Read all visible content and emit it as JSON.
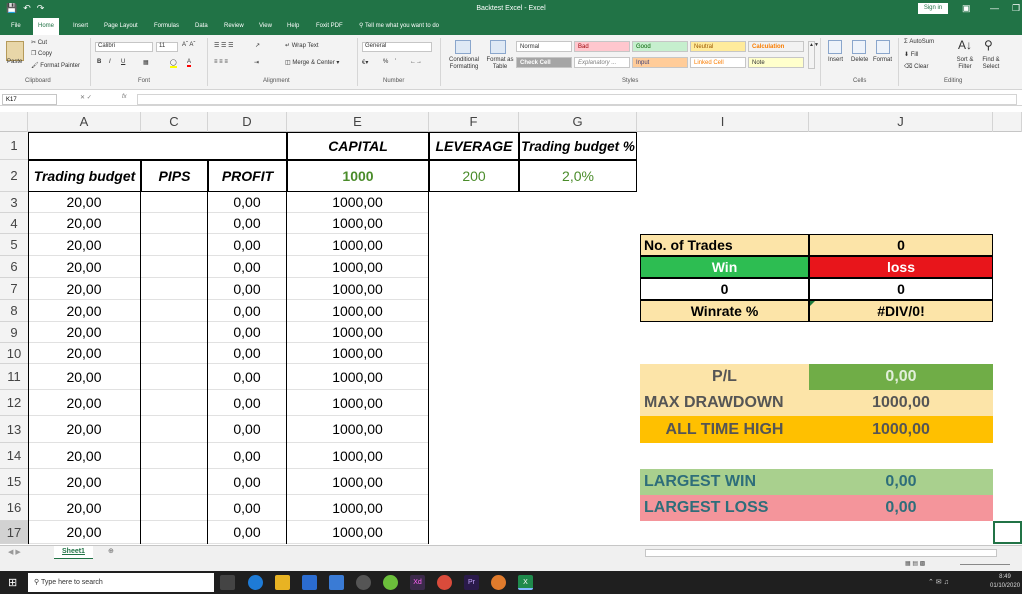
{
  "app": {
    "doc_title": "Backtest Excel  -  Excel",
    "sign_in": "Sign in"
  },
  "menu": {
    "tabs": [
      "File",
      "Home",
      "Insert",
      "Page Layout",
      "Formulas",
      "Data",
      "Review",
      "View",
      "Help",
      "Foxit PDF"
    ],
    "active": "Home",
    "tell_me": "Tell me what you want to do"
  },
  "ribbon": {
    "clipboard": {
      "paste": "Paste",
      "cut": "Cut",
      "copy": "Copy",
      "format_painter": "Format Painter",
      "label": "Clipboard"
    },
    "font": {
      "name": "Calibri",
      "size": "11",
      "label": "Font",
      "bold": "B",
      "italic": "I",
      "underline": "U"
    },
    "alignment": {
      "wrap_text": "Wrap Text",
      "merge_center": "Merge & Center",
      "label": "Alignment"
    },
    "number": {
      "format": "General",
      "percent": "%",
      "label": "Number"
    },
    "styles": {
      "conditional": "Conditional Formatting",
      "format_as_table": "Format as Table",
      "normal": "Normal",
      "bad": "Bad",
      "good": "Good",
      "neutral": "Neutral",
      "calculation": "Calculation",
      "check_cell": "Check Cell",
      "explanatory": "Explanatory ...",
      "input": "Input",
      "linked_cell": "Linked Cell",
      "note": "Note",
      "label": "Styles"
    },
    "cells": {
      "insert": "Insert",
      "delete": "Delete",
      "format": "Format",
      "label": "Cells"
    },
    "editing": {
      "autosum": "AutoSum",
      "fill": "Fill",
      "clear": "Clear",
      "sort_filter": "Sort & Filter",
      "find_select": "Find & Select",
      "label": "Editing"
    }
  },
  "formula_bar": {
    "name_box": "K17",
    "fx": "fx",
    "value": ""
  },
  "columns": [
    "A",
    "C",
    "D",
    "E",
    "F",
    "G",
    "I",
    "J"
  ],
  "rows": [
    "1",
    "2",
    "3",
    "4",
    "5",
    "6",
    "7",
    "8",
    "9",
    "10",
    "11",
    "12",
    "13",
    "14",
    "15",
    "16",
    "17"
  ],
  "headers": {
    "capital": "CAPITAL",
    "leverage": "LEVERAGE",
    "budget_pct_label": "Trading budget %",
    "trading_budget": "Trading budget",
    "pips": "PIPS",
    "profit": "PROFIT",
    "capital_value": "1000",
    "leverage_value": "200",
    "budget_pct_value": "2,0%"
  },
  "data_rows": [
    {
      "budget": "20,00",
      "pips": "",
      "profit": "0,00",
      "capital": "1000,00"
    },
    {
      "budget": "20,00",
      "pips": "",
      "profit": "0,00",
      "capital": "1000,00"
    },
    {
      "budget": "20,00",
      "pips": "",
      "profit": "0,00",
      "capital": "1000,00"
    },
    {
      "budget": "20,00",
      "pips": "",
      "profit": "0,00",
      "capital": "1000,00"
    },
    {
      "budget": "20,00",
      "pips": "",
      "profit": "0,00",
      "capital": "1000,00"
    },
    {
      "budget": "20,00",
      "pips": "",
      "profit": "0,00",
      "capital": "1000,00"
    },
    {
      "budget": "20,00",
      "pips": "",
      "profit": "0,00",
      "capital": "1000,00"
    },
    {
      "budget": "20,00",
      "pips": "",
      "profit": "0,00",
      "capital": "1000,00"
    },
    {
      "budget": "20,00",
      "pips": "",
      "profit": "0,00",
      "capital": "1000,00"
    },
    {
      "budget": "20,00",
      "pips": "",
      "profit": "0,00",
      "capital": "1000,00"
    },
    {
      "budget": "20,00",
      "pips": "",
      "profit": "0,00",
      "capital": "1000,00"
    },
    {
      "budget": "20,00",
      "pips": "",
      "profit": "0,00",
      "capital": "1000,00"
    },
    {
      "budget": "20,00",
      "pips": "",
      "profit": "0,00",
      "capital": "1000,00"
    },
    {
      "budget": "20,00",
      "pips": "",
      "profit": "0,00",
      "capital": "1000,00"
    },
    {
      "budget": "20,00",
      "pips": "",
      "profit": "0,00",
      "capital": "1000,00"
    }
  ],
  "stats": {
    "no_trades_label": "No. of Trades",
    "no_trades_value": "0",
    "win_label": "Win",
    "loss_label": "loss",
    "win_value": "0",
    "loss_value": "0",
    "winrate_label": "Winrate %",
    "winrate_value": "#DIV/0!",
    "pl_label": "P/L",
    "pl_value": "0,00",
    "max_dd_label": "MAX DRAWDOWN",
    "max_dd_value": "1000,00",
    "ath_label": "ALL TIME HIGH",
    "ath_value": "1000,00",
    "largest_win_label": "LARGEST WIN",
    "largest_win_value": "0,00",
    "largest_loss_label": "LARGEST LOSS",
    "largest_loss_value": "0,00"
  },
  "colors": {
    "excel_green": "#217346",
    "peach": "#fce4a8",
    "win_green": "#2dbd52",
    "loss_red": "#e8151b",
    "pl_green": "#70ad47",
    "orange": "#ffc000",
    "light_green": "#a9d08e",
    "pink": "#f4959b"
  },
  "sheet": {
    "tab": "Sheet1"
  },
  "taskbar": {
    "search": "Type here to search",
    "time": "8:49",
    "date": "01/10/2020"
  }
}
